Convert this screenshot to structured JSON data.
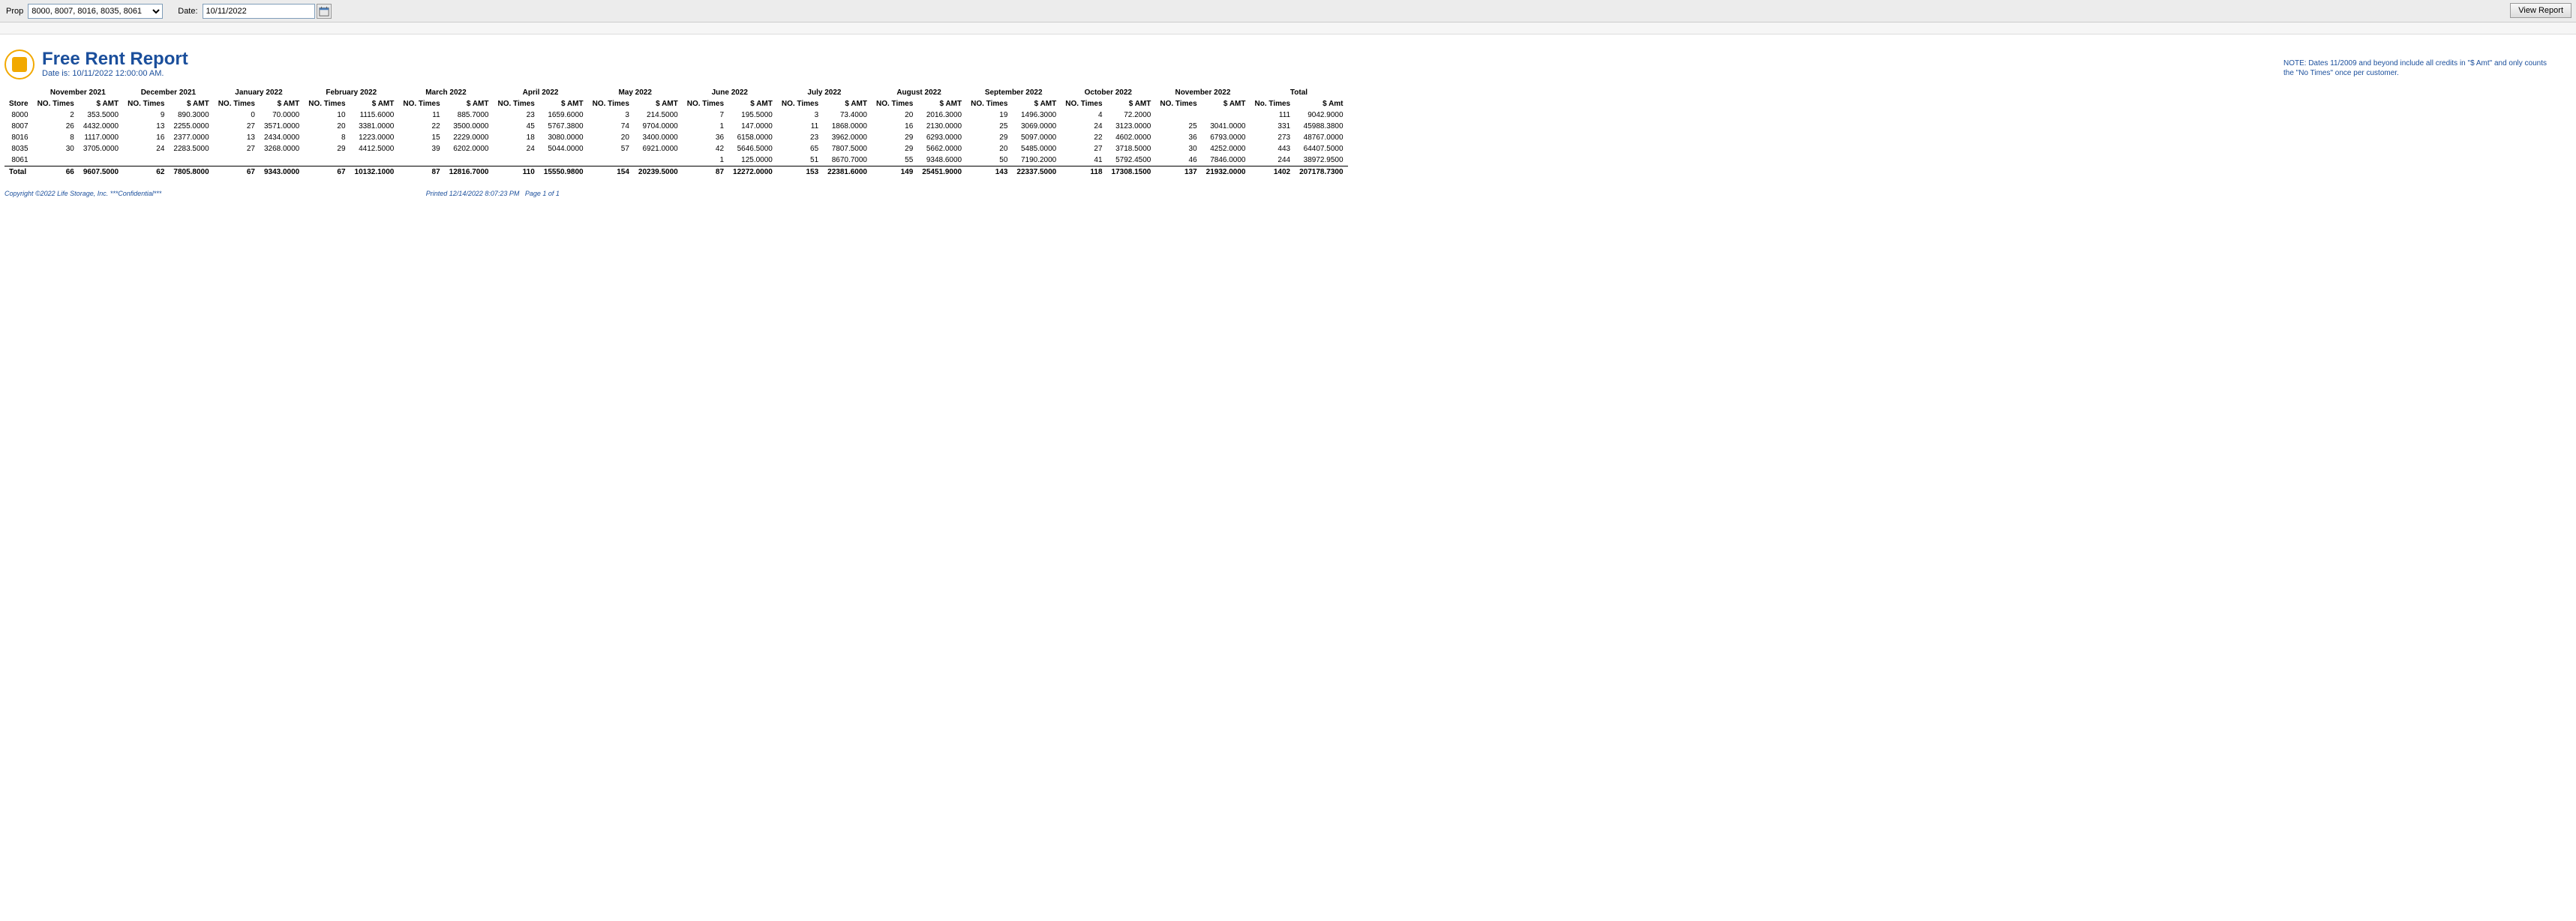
{
  "params": {
    "prop_label": "Prop",
    "prop_value": "8000, 8007, 8016, 8035, 8061",
    "date_label": "Date:",
    "date_value": "10/11/2022",
    "view_report": "View Report"
  },
  "tiny_center": "",
  "header": {
    "title": "Free Rent Report",
    "subtitle": "Date is: 10/11/2022 12:00:00 AM.",
    "note": "NOTE: Dates 11/2009 and beyond include all credits in \"$ Amt\" and only counts the \"No Times\" once per customer."
  },
  "columns": {
    "store": "Store",
    "no_times": "NO. Times",
    "amt": "$ AMT",
    "no_times_total": "No. Times",
    "amt_total": "$ Amt"
  },
  "chart_data": {
    "type": "table",
    "months": [
      "November 2021",
      "December 2021",
      "January 2022",
      "February 2022",
      "March 2022",
      "April 2022",
      "May 2022",
      "June 2022",
      "July 2022",
      "August 2022",
      "September 2022",
      "October 2022",
      "November 2022",
      "Total"
    ],
    "rows": [
      {
        "store": "8000",
        "cells": [
          [
            "2",
            "353.5000"
          ],
          [
            "9",
            "890.3000"
          ],
          [
            "0",
            "70.0000"
          ],
          [
            "10",
            "1115.6000"
          ],
          [
            "11",
            "885.7000"
          ],
          [
            "23",
            "1659.6000"
          ],
          [
            "3",
            "214.5000"
          ],
          [
            "7",
            "195.5000"
          ],
          [
            "3",
            "73.4000"
          ],
          [
            "20",
            "2016.3000"
          ],
          [
            "19",
            "1496.3000"
          ],
          [
            "4",
            "72.2000"
          ],
          [
            "",
            ""
          ],
          [
            "111",
            "9042.9000"
          ]
        ]
      },
      {
        "store": "8007",
        "cells": [
          [
            "26",
            "4432.0000"
          ],
          [
            "13",
            "2255.0000"
          ],
          [
            "27",
            "3571.0000"
          ],
          [
            "20",
            "3381.0000"
          ],
          [
            "22",
            "3500.0000"
          ],
          [
            "45",
            "5767.3800"
          ],
          [
            "74",
            "9704.0000"
          ],
          [
            "1",
            "147.0000"
          ],
          [
            "11",
            "1868.0000"
          ],
          [
            "16",
            "2130.0000"
          ],
          [
            "25",
            "3069.0000"
          ],
          [
            "24",
            "3123.0000"
          ],
          [
            "25",
            "3041.0000"
          ],
          [
            "331",
            "45988.3800"
          ]
        ]
      },
      {
        "store": "8016",
        "cells": [
          [
            "8",
            "1117.0000"
          ],
          [
            "16",
            "2377.0000"
          ],
          [
            "13",
            "2434.0000"
          ],
          [
            "8",
            "1223.0000"
          ],
          [
            "15",
            "2229.0000"
          ],
          [
            "18",
            "3080.0000"
          ],
          [
            "20",
            "3400.0000"
          ],
          [
            "36",
            "6158.0000"
          ],
          [
            "23",
            "3962.0000"
          ],
          [
            "29",
            "6293.0000"
          ],
          [
            "29",
            "5097.0000"
          ],
          [
            "22",
            "4602.0000"
          ],
          [
            "36",
            "6793.0000"
          ],
          [
            "273",
            "48767.0000"
          ]
        ]
      },
      {
        "store": "8035",
        "cells": [
          [
            "30",
            "3705.0000"
          ],
          [
            "24",
            "2283.5000"
          ],
          [
            "27",
            "3268.0000"
          ],
          [
            "29",
            "4412.5000"
          ],
          [
            "39",
            "6202.0000"
          ],
          [
            "24",
            "5044.0000"
          ],
          [
            "57",
            "6921.0000"
          ],
          [
            "42",
            "5646.5000"
          ],
          [
            "65",
            "7807.5000"
          ],
          [
            "29",
            "5662.0000"
          ],
          [
            "20",
            "5485.0000"
          ],
          [
            "27",
            "3718.5000"
          ],
          [
            "30",
            "4252.0000"
          ],
          [
            "443",
            "64407.5000"
          ]
        ]
      },
      {
        "store": "8061",
        "cells": [
          [
            "",
            ""
          ],
          [
            "",
            ""
          ],
          [
            "",
            ""
          ],
          [
            "",
            ""
          ],
          [
            "",
            ""
          ],
          [
            "",
            ""
          ],
          [
            "",
            ""
          ],
          [
            "1",
            "125.0000"
          ],
          [
            "51",
            "8670.7000"
          ],
          [
            "55",
            "9348.6000"
          ],
          [
            "50",
            "7190.2000"
          ],
          [
            "41",
            "5792.4500"
          ],
          [
            "46",
            "7846.0000"
          ],
          [
            "244",
            "38972.9500"
          ]
        ]
      }
    ],
    "total": {
      "label": "Total",
      "cells": [
        [
          "66",
          "9607.5000"
        ],
        [
          "62",
          "7805.8000"
        ],
        [
          "67",
          "9343.0000"
        ],
        [
          "67",
          "10132.1000"
        ],
        [
          "87",
          "12816.7000"
        ],
        [
          "110",
          "15550.9800"
        ],
        [
          "154",
          "20239.5000"
        ],
        [
          "87",
          "12272.0000"
        ],
        [
          "153",
          "22381.6000"
        ],
        [
          "149",
          "25451.9000"
        ],
        [
          "143",
          "22337.5000"
        ],
        [
          "118",
          "17308.1500"
        ],
        [
          "137",
          "21932.0000"
        ],
        [
          "1402",
          "207178.7300"
        ]
      ]
    }
  },
  "footer": {
    "copyright": "Copyright ©2022 Life Storage, Inc. ***Confidential***",
    "printed": "Printed 12/14/2022 8:07:23 PM",
    "page": "Page 1 of 1"
  }
}
